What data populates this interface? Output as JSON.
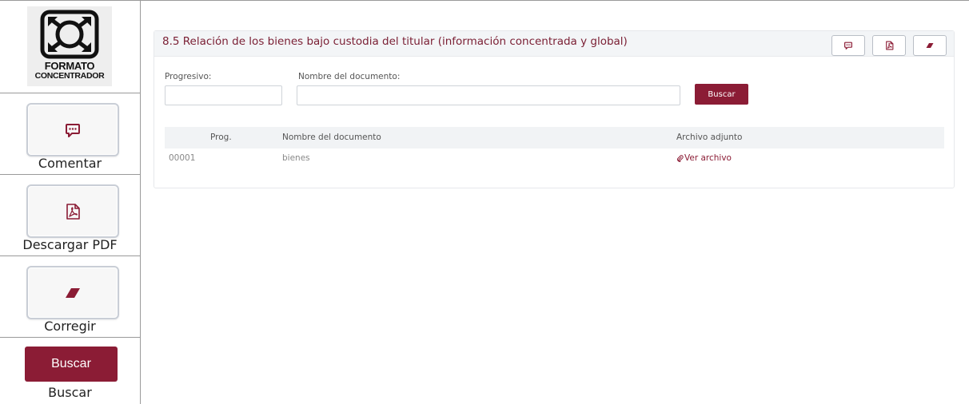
{
  "legend": {
    "logo": {
      "line1": "FORMATO",
      "line2": "CONCENTRADOR",
      "icon": "concentrator-icon"
    },
    "items": [
      {
        "icon": "comment-icon",
        "caption": "Comentar"
      },
      {
        "icon": "pdf-icon",
        "caption": "Descargar PDF"
      },
      {
        "icon": "eraser-icon",
        "caption": "Corregir"
      },
      {
        "button_label": "Buscar",
        "caption": "Buscar"
      }
    ]
  },
  "card": {
    "title": "8.5 Relación de los bienes bajo custodia del titular (información concentrada y global)",
    "header_buttons": [
      {
        "icon": "comment-icon"
      },
      {
        "icon": "pdf-icon"
      },
      {
        "icon": "eraser-icon"
      }
    ]
  },
  "search": {
    "progresivo_label": "Progresivo:",
    "progresivo_value": "",
    "nombre_label": "Nombre del documento:",
    "nombre_value": "",
    "button_label": "Buscar"
  },
  "table": {
    "columns": [
      "Prog.",
      "Nombre del documento",
      "Archivo adjunto"
    ],
    "rows": [
      {
        "prog": "00001",
        "nombre": "bienes",
        "archivo": "Ver archivo"
      }
    ]
  },
  "colors": {
    "accent": "#8b1c35",
    "title": "#7a1e33",
    "header_bg": "#f3f5f7",
    "table_head_bg": "#f1f3f5"
  }
}
